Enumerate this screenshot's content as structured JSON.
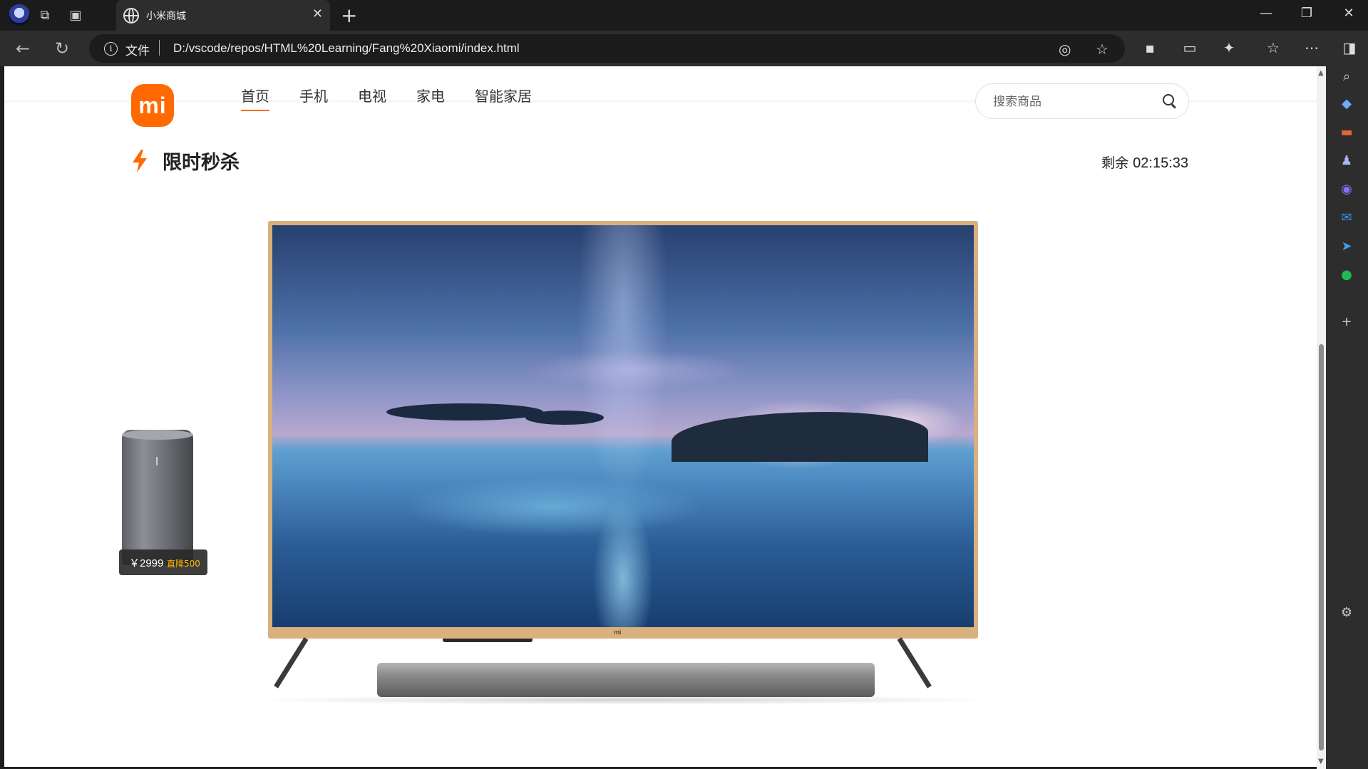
{
  "browser": {
    "tab_title": "小米商城",
    "address_scheme": "文件",
    "address_url": "D:/vscode/repos/HTML%20Learning/Fang%20Xiaomi/index.html",
    "tab_close_glyph": "✕",
    "new_tab_glyph": "+"
  },
  "header": {
    "logo_text": "mi",
    "nav": [
      "首页",
      "手机",
      "电视",
      "家电",
      "智能家居"
    ],
    "active_nav": "首页",
    "search_placeholder": "搜索商品"
  },
  "flash_sale": {
    "title": "限时秒杀",
    "countdown_label": "剩余",
    "countdown_time": "02:15:33"
  },
  "product": {
    "price": "￥2999",
    "discount": "直降500",
    "tv_brand_mark": "mi"
  },
  "colors": {
    "accent": "#ff6900",
    "discount": "#ffb800"
  }
}
